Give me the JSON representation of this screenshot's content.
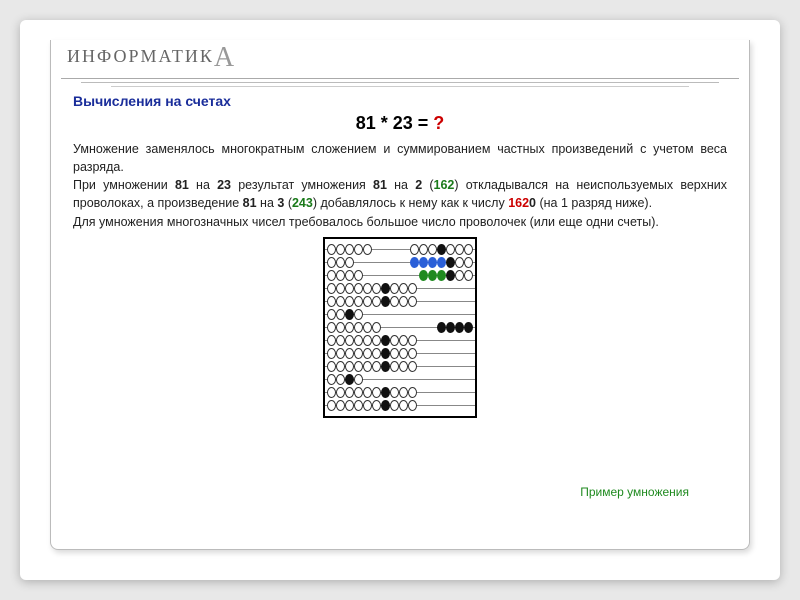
{
  "logo": {
    "prefix": "ИНФОРМАТИК",
    "big": "А"
  },
  "title": "Вычисления на счетах",
  "equation": {
    "lhs": "81 * 23 =",
    "rhs": "?"
  },
  "para": {
    "p1": "Умножение заменялось многократным сложением и суммированием частных произведений с учетом веса разряда.",
    "p2a": "При умножении ",
    "p2b": " на ",
    "p2c": " результат умножения ",
    "p2d": " (",
    "p2e": ") откладывался на неиспользуемых верхних проволоках, а произведение ",
    "p2f": " (",
    "p2g": ") добавлялось к нему как к числу ",
    "p2h": " (на 1 разряд ниже).",
    "p3": "Для умножения многозначных чисел требовалось большое число проволочек (или еще одни счеты).",
    "n81": "81",
    "n23": "23",
    "n2": "2",
    "n3": "3",
    "v162": "162",
    "v1620": "162",
    "v1620z": "0",
    "v243": "243"
  },
  "caption": "Пример умножения",
  "abacus": {
    "r1": {
      "left": [
        {
          "t": "e"
        },
        {
          "t": "e"
        },
        {
          "t": "e"
        },
        {
          "t": "e"
        },
        {
          "t": "e"
        }
      ],
      "right": [
        {
          "t": "e"
        },
        {
          "t": "e"
        },
        {
          "t": "e"
        },
        {
          "t": "k"
        },
        {
          "t": "e"
        },
        {
          "t": "e"
        },
        {
          "t": "e"
        }
      ]
    },
    "r2": {
      "left": [
        {
          "t": "e"
        },
        {
          "t": "e"
        },
        {
          "t": "e"
        }
      ],
      "right": [
        {
          "t": "bl"
        },
        {
          "t": "bl"
        },
        {
          "t": "bl"
        },
        {
          "t": "bl"
        },
        {
          "t": "k"
        },
        {
          "t": "e"
        },
        {
          "t": "e"
        }
      ]
    },
    "r3": {
      "left": [
        {
          "t": "e"
        },
        {
          "t": "e"
        },
        {
          "t": "e"
        },
        {
          "t": "e"
        }
      ],
      "right": [
        {
          "t": "gr"
        },
        {
          "t": "gr"
        },
        {
          "t": "gr"
        },
        {
          "t": "k"
        },
        {
          "t": "e"
        },
        {
          "t": "e"
        }
      ]
    },
    "r4": {
      "left": [
        {
          "t": "e"
        },
        {
          "t": "e"
        },
        {
          "t": "e"
        },
        {
          "t": "e"
        },
        {
          "t": "e"
        },
        {
          "t": "e"
        },
        {
          "t": "k"
        },
        {
          "t": "e"
        },
        {
          "t": "e"
        },
        {
          "t": "e"
        }
      ],
      "right": []
    },
    "r5": {
      "left": [
        {
          "t": "e"
        },
        {
          "t": "e"
        },
        {
          "t": "e"
        },
        {
          "t": "e"
        },
        {
          "t": "e"
        },
        {
          "t": "e"
        },
        {
          "t": "k"
        },
        {
          "t": "e"
        },
        {
          "t": "e"
        },
        {
          "t": "e"
        }
      ],
      "right": []
    },
    "r6": {
      "left": [
        {
          "t": "e"
        },
        {
          "t": "e"
        },
        {
          "t": "k"
        },
        {
          "t": "e"
        }
      ],
      "right": []
    },
    "r7": {
      "left": [
        {
          "t": "e"
        },
        {
          "t": "e"
        },
        {
          "t": "e"
        },
        {
          "t": "e"
        },
        {
          "t": "e"
        },
        {
          "t": "e"
        }
      ],
      "right": [
        {
          "t": "k"
        },
        {
          "t": "k"
        },
        {
          "t": "k"
        },
        {
          "t": "k"
        }
      ]
    },
    "r8": {
      "left": [
        {
          "t": "e"
        },
        {
          "t": "e"
        },
        {
          "t": "e"
        },
        {
          "t": "e"
        },
        {
          "t": "e"
        },
        {
          "t": "e"
        },
        {
          "t": "k"
        },
        {
          "t": "e"
        },
        {
          "t": "e"
        },
        {
          "t": "e"
        }
      ],
      "right": []
    },
    "r9": {
      "left": [
        {
          "t": "e"
        },
        {
          "t": "e"
        },
        {
          "t": "e"
        },
        {
          "t": "e"
        },
        {
          "t": "e"
        },
        {
          "t": "e"
        },
        {
          "t": "k"
        },
        {
          "t": "e"
        },
        {
          "t": "e"
        },
        {
          "t": "e"
        }
      ],
      "right": []
    },
    "r10": {
      "left": [
        {
          "t": "e"
        },
        {
          "t": "e"
        },
        {
          "t": "e"
        },
        {
          "t": "e"
        },
        {
          "t": "e"
        },
        {
          "t": "e"
        },
        {
          "t": "k"
        },
        {
          "t": "e"
        },
        {
          "t": "e"
        },
        {
          "t": "e"
        }
      ],
      "right": []
    },
    "r11": {
      "left": [
        {
          "t": "e"
        },
        {
          "t": "e"
        },
        {
          "t": "k"
        },
        {
          "t": "e"
        }
      ],
      "right": []
    },
    "r12": {
      "left": [
        {
          "t": "e"
        },
        {
          "t": "e"
        },
        {
          "t": "e"
        },
        {
          "t": "e"
        },
        {
          "t": "e"
        },
        {
          "t": "e"
        },
        {
          "t": "k"
        },
        {
          "t": "e"
        },
        {
          "t": "e"
        },
        {
          "t": "e"
        }
      ],
      "right": []
    },
    "r13": {
      "left": [
        {
          "t": "e"
        },
        {
          "t": "e"
        },
        {
          "t": "e"
        },
        {
          "t": "e"
        },
        {
          "t": "e"
        },
        {
          "t": "e"
        },
        {
          "t": "k"
        },
        {
          "t": "e"
        },
        {
          "t": "e"
        },
        {
          "t": "e"
        }
      ],
      "right": []
    }
  }
}
